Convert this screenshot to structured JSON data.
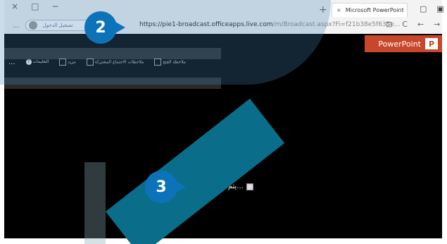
{
  "browser": {
    "window_controls": [
      "×",
      "□",
      "−"
    ],
    "new_tab": "+",
    "tab": {
      "close": "×",
      "title": "Microsoft PowerPoint"
    },
    "more": "...",
    "profile_label": "تسجيل الدخول",
    "url_main": "https://pie1-broadcast.officeapps.live.com",
    "url_rest": "/m/Broadcast.aspx?Fi=f21b38e5f635e...",
    "reload": "C",
    "back": "←",
    "forward": "→"
  },
  "viewer": {
    "badge": "PowerPoint",
    "logo": "P",
    "toolbar": {
      "more": "...",
      "help": "?",
      "item1": "التعليمات",
      "item2": "مزيد",
      "item3": "ملاحظات الاجتماع المشتركة",
      "item4": "ملاحظة الفتح"
    },
    "loading": "يتم الآن التحميل..."
  },
  "callouts": {
    "step2": "2",
    "step3": "3"
  }
}
